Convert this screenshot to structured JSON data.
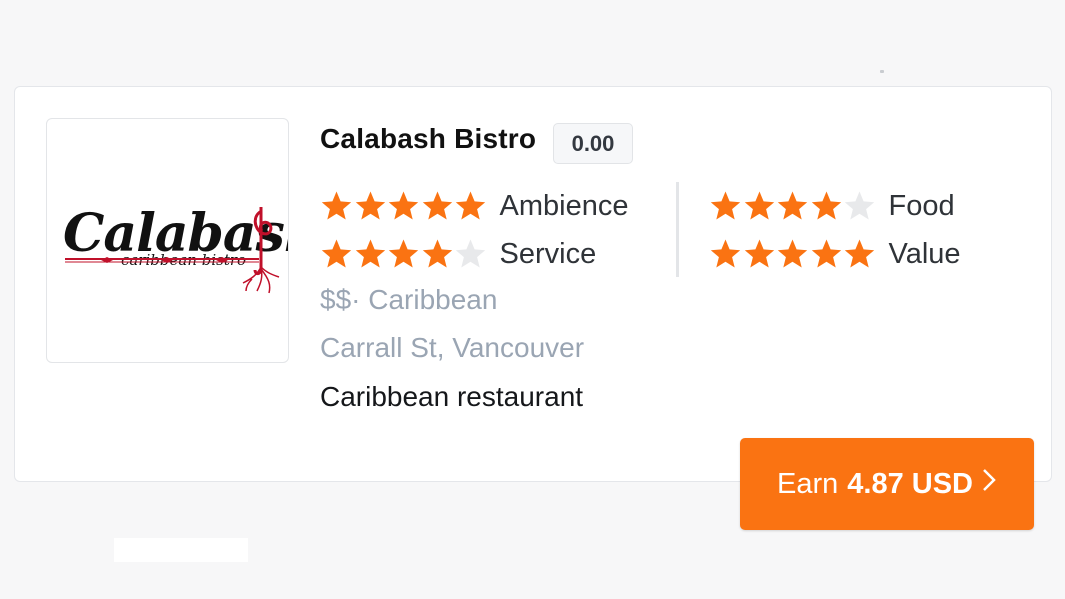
{
  "restaurant": {
    "name": "Calabash Bistro",
    "score": "0.00",
    "logo_text": "Calabash",
    "logo_subtext": "caribbean bistro",
    "price_cuisine": "$$· Caribbean",
    "address": "Carrall St, Vancouver",
    "description": "Caribbean restaurant"
  },
  "ratings": [
    {
      "label": "Ambience",
      "stars": 5,
      "max": 5
    },
    {
      "label": "Service",
      "stars": 4,
      "max": 5
    },
    {
      "label": "Food",
      "stars": 4,
      "max": 5
    },
    {
      "label": "Value",
      "stars": 5,
      "max": 5
    }
  ],
  "earn_button": {
    "prefix": "Earn",
    "amount": "4.87 USD",
    "icon": "chevron-right-icon"
  },
  "colors": {
    "star_filled": "#fa7312",
    "star_empty": "#e8e9eb",
    "button": "#fa7312",
    "logo_accent": "#c0102a"
  }
}
